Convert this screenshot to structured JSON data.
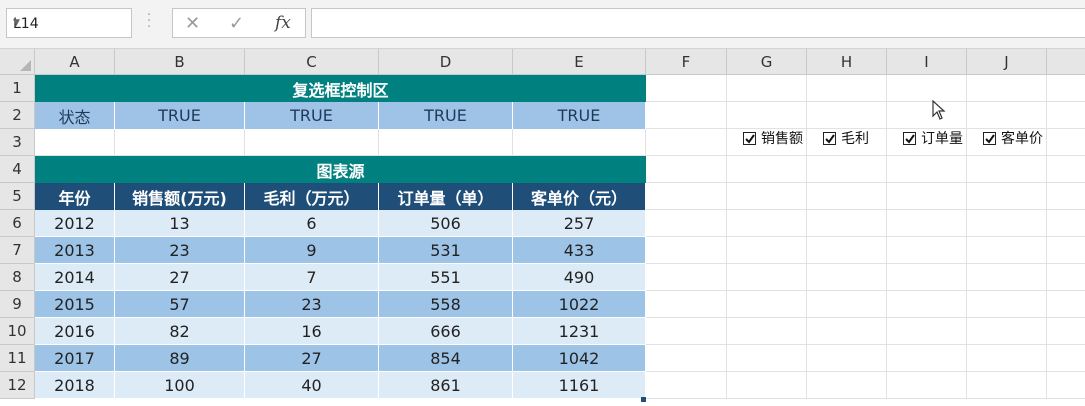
{
  "formula_bar": {
    "name_box": "L14",
    "fx_label": "fx",
    "cancel_icon": "✕",
    "enter_icon": "✓",
    "formula": ""
  },
  "columns": [
    "A",
    "B",
    "C",
    "D",
    "E",
    "F",
    "G",
    "H",
    "I",
    "J"
  ],
  "rows": [
    "1",
    "2",
    "3",
    "4",
    "5",
    "6",
    "7",
    "8",
    "9",
    "10",
    "11",
    "12"
  ],
  "control_area": {
    "title": "复选框控制区",
    "status_label": "状态",
    "values": [
      "TRUE",
      "TRUE",
      "TRUE",
      "TRUE"
    ]
  },
  "chart_source": {
    "title": "图表源",
    "headers": [
      "年份",
      "销售额(万元)",
      "毛利（万元）",
      "订单量（单）",
      "客单价（元）"
    ],
    "data": [
      [
        "2012",
        "13",
        "6",
        "506",
        "257"
      ],
      [
        "2013",
        "23",
        "9",
        "531",
        "433"
      ],
      [
        "2014",
        "27",
        "7",
        "551",
        "490"
      ],
      [
        "2015",
        "57",
        "23",
        "558",
        "1022"
      ],
      [
        "2016",
        "82",
        "16",
        "666",
        "1231"
      ],
      [
        "2017",
        "89",
        "27",
        "854",
        "1042"
      ],
      [
        "2018",
        "100",
        "40",
        "861",
        "1161"
      ]
    ]
  },
  "checkboxes": [
    {
      "label": "销售额",
      "checked": true
    },
    {
      "label": "毛利",
      "checked": true
    },
    {
      "label": "订单量",
      "checked": true
    },
    {
      "label": "客单价",
      "checked": true
    }
  ],
  "colors": {
    "teal": "#00807f",
    "header_blue": "#1f4e79",
    "band_light": "#ddebf7",
    "band_dark": "#9dc3e6"
  }
}
